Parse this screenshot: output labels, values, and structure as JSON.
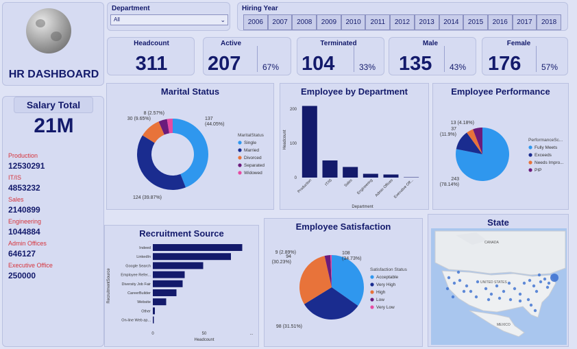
{
  "title": "HR DASHBOARD",
  "salary": {
    "label": "Salary Total",
    "total": "21M",
    "departments": [
      {
        "name": "Production",
        "value": "12530291"
      },
      {
        "name": "IT/IS",
        "value": "4853232"
      },
      {
        "name": "Sales",
        "value": "2140899"
      },
      {
        "name": "Engineering",
        "value": "1044884"
      },
      {
        "name": "Admin Offices",
        "value": "646127"
      },
      {
        "name": "Executive Office",
        "value": "250000"
      }
    ]
  },
  "slicers": {
    "department": {
      "label": "Department",
      "value": "All"
    },
    "hiring_year": {
      "label": "Hiring Year",
      "years": [
        "2006",
        "2007",
        "2008",
        "2009",
        "2010",
        "2011",
        "2012",
        "2013",
        "2014",
        "2015",
        "2016",
        "2017",
        "2018"
      ]
    }
  },
  "kpis": {
    "headcount": {
      "label": "Headcount",
      "value": "311"
    },
    "active": {
      "label": "Active",
      "value": "207",
      "pct": "67%"
    },
    "terminated": {
      "label": "Terminated",
      "value": "104",
      "pct": "33%"
    },
    "male": {
      "label": "Male",
      "value": "135",
      "pct": "43%"
    },
    "female": {
      "label": "Female",
      "value": "176",
      "pct": "57%"
    }
  },
  "colors": {
    "navy": "#131a6b",
    "blue": "#2f97ee",
    "dark_blue": "#1a2c8f",
    "orange": "#e8733a",
    "purple": "#6b1b7b",
    "pink": "#e64ba2"
  },
  "chart_data": [
    {
      "type": "pie",
      "title": "Marital Status",
      "donut": true,
      "legend_title": "MaritalStatus",
      "categories": [
        "Single",
        "Married",
        "Divorced",
        "Separated",
        "Widowed"
      ],
      "values": [
        137,
        124,
        30,
        12,
        8
      ],
      "colors": [
        "#2f97ee",
        "#1a2c8f",
        "#e8733a",
        "#6b1b7b",
        "#e64ba2"
      ],
      "labels": [
        "137\n(44.05%)",
        "124 (39.87%)",
        "30 (9.65%)",
        "",
        "8 (2.57%)"
      ]
    },
    {
      "type": "bar",
      "title": "Employee by Department",
      "categories": [
        "Production",
        "IT/IS",
        "Sales",
        "Engineering",
        "Admin Offices",
        "Executive Off..."
      ],
      "values": [
        209,
        50,
        31,
        11,
        9,
        1
      ],
      "ylabel": "Headcount",
      "xlabel": "Department",
      "yticks": [
        "0",
        "100",
        "200"
      ],
      "ylim": [
        0,
        220
      ]
    },
    {
      "type": "pie",
      "title": "Employee Performance",
      "legend_title": "PerformanceSc...",
      "categories": [
        "Fully Meets",
        "Exceeds",
        "Needs Impro...",
        "PIP"
      ],
      "values": [
        243,
        37,
        13,
        18
      ],
      "colors": [
        "#2f97ee",
        "#1a2c8f",
        "#e8733a",
        "#6b1b7b"
      ],
      "labels": [
        "243\n(78.14%)",
        "37\n(11.9%)",
        "13 (4.18%)",
        ""
      ]
    },
    {
      "type": "bar",
      "orientation": "horizontal",
      "title": "Recruitment Source",
      "categories": [
        "Indeed",
        "LinkedIn",
        "Google Search",
        "Employee Refer...",
        "Diversity Job Fair",
        "CareerBuilder",
        "Website",
        "Other",
        "On-line Web ap..."
      ],
      "values": [
        87,
        76,
        49,
        31,
        29,
        23,
        13,
        2,
        1
      ],
      "xlabel": "Headcount",
      "ylabel": "RecruitmentSource",
      "xticks": [
        "0",
        "50",
        "..."
      ],
      "xlim": [
        0,
        100
      ]
    },
    {
      "type": "pie",
      "title": "Employee Satisfaction",
      "legend_title": "Satisfaction Status",
      "categories": [
        "Acceptable",
        "Very High",
        "High",
        "Low",
        "Very Low"
      ],
      "values": [
        108,
        98,
        94,
        9,
        2
      ],
      "colors": [
        "#2f97ee",
        "#1a2c8f",
        "#e8733a",
        "#6b1b7b",
        "#e64ba2"
      ],
      "labels": [
        "108\n(34.73%)",
        "98 (31.51%)",
        "94\n(30.23%)",
        "9 (2.89%)",
        ""
      ]
    }
  ],
  "map": {
    "title": "State",
    "labels": [
      "CANADA",
      "UNITED STATES",
      "MEXICO"
    ]
  }
}
